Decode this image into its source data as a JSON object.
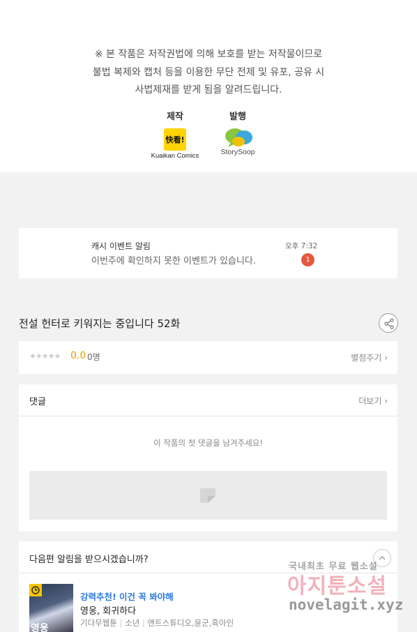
{
  "copyright": {
    "lines": [
      "※ 본 작품은 저작권법에 의해 보호를 받는 저작물이므로",
      "불법 복제와 캡처 등을 이용한 무단 전제 및 유포, 공유 시",
      "사법제재를 받게 됨을 알려드립니다."
    ],
    "producer_label": "제작",
    "producer_logo_text": "快看!",
    "producer_name": "Kuaikan Comics",
    "publisher_label": "발행",
    "publisher_name": "StorySoop"
  },
  "notice": {
    "title": "캐시 이벤트 알림",
    "body": "이번주에 확인하지 못한 이벤트가 있습니다.",
    "time": "오후 7:32",
    "badge": "1"
  },
  "episode": {
    "title": "전설 헌터로 키워지는 중입니다 52화"
  },
  "rating": {
    "stars": "★★★★★",
    "score": "0.0",
    "count": "0명",
    "rate_link": "별점주기 ›"
  },
  "comments": {
    "title": "댓글",
    "more": "더보기 ›",
    "empty_text": "이 작품의 첫 댓글을 남겨주세요!"
  },
  "next": {
    "title": "다음편 알림을 받으시겠습니까?",
    "thumb_caption": "영웅",
    "tag": "강력추천! 이건 꼭 봐야해",
    "rec_title": "영웅, 회귀하다",
    "meta_genre_publisher": "기다무웹툰",
    "meta_category": "소년",
    "meta_authors": "앤트스튜디오,윤군,흑아인"
  },
  "watermark": {
    "line1": "국내최초 무료 웹소설",
    "line2": "아지툰소설",
    "line3": "novelagit.xyz"
  },
  "colors": {
    "accent_orange": "#e8a000",
    "badge_red": "#e35a3e",
    "tag_blue": "#2c7be5",
    "kuaikan_yellow": "#ffd400"
  }
}
